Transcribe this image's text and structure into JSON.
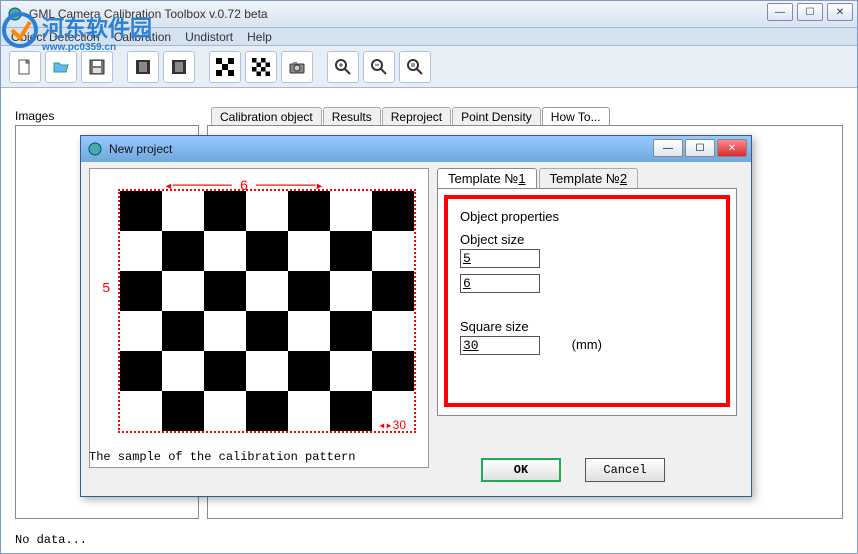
{
  "app": {
    "title": "GML Camera Calibration Toolbox  v.0.72 beta",
    "menu": [
      "Object Detection",
      "Calibration",
      "Undistort",
      "Help"
    ],
    "images_label": "Images",
    "nodata": "No data...",
    "watermark": "河东软件园",
    "watermark_url": "www.pc0359.cn"
  },
  "tabs": {
    "items": [
      "Calibration object",
      "Results",
      "Reproject",
      "Point Density",
      "How To..."
    ],
    "active": 4
  },
  "toolbar": {
    "new": "new-icon",
    "open": "open-icon",
    "save": "save-icon",
    "film_prev": "film-prev-icon",
    "film_next": "film-next-icon",
    "checker1": "checker-icon",
    "checker2": "checker2-icon",
    "camera": "camera-icon",
    "zoom_in": "zoom-in-icon",
    "zoom_out": "zoom-out-icon",
    "zoom_fit": "zoom-fit-icon"
  },
  "dialog": {
    "title": "New project",
    "caption": "The sample of the calibration pattern",
    "tabs": [
      "Template №1",
      "Template №2"
    ],
    "active_tab": 0,
    "object_properties_label": "Object properties",
    "object_size_label": "Object size",
    "object_size_w": "5",
    "object_size_h": "6",
    "square_size_label": "Square size",
    "square_size": "30",
    "unit": "(mm)",
    "ok": "OK",
    "cancel": "Cancel",
    "dim_cols": "6",
    "dim_rows": "5",
    "dim_sq": "30"
  }
}
